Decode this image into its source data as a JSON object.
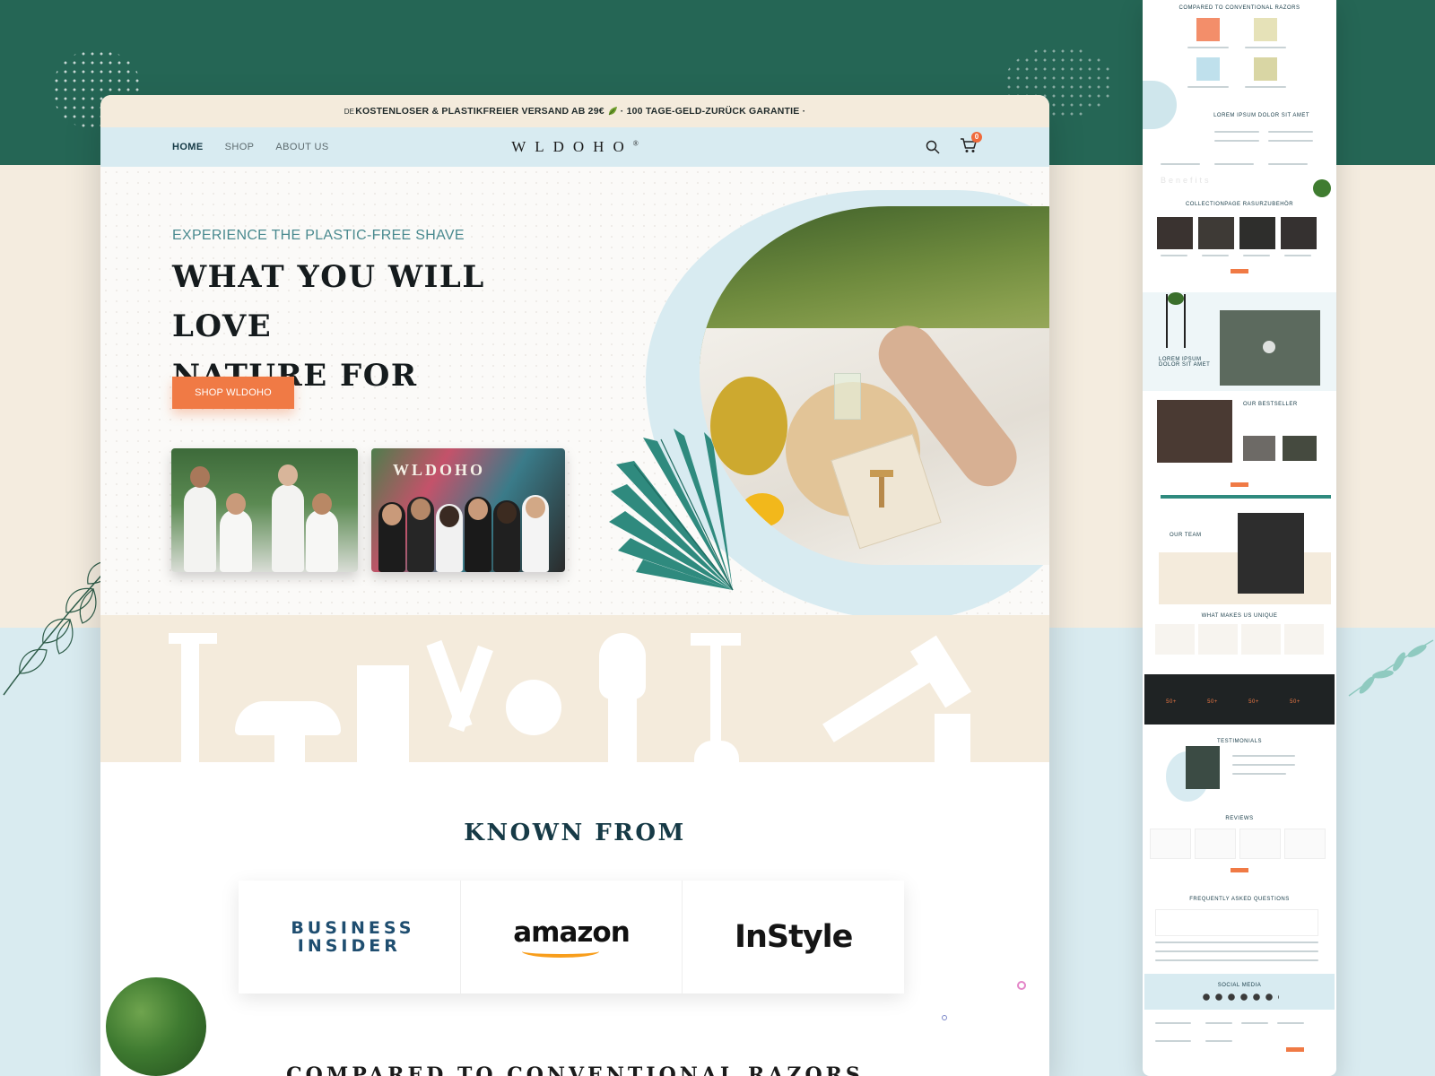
{
  "promo": {
    "lang": "DE",
    "text": "KOSTENLOSER & PLASTIKFREIER VERSAND AB 29€",
    "tail": "· 100 TAGE-GELD-ZURÜCK GARANTIE ·"
  },
  "nav": {
    "links": [
      "HOME",
      "SHOP",
      "ABOUT US"
    ],
    "logo": "WLDOHO",
    "logo_mark": "®",
    "cart_count": "0"
  },
  "hero": {
    "eyebrow": "EXPERIENCE THE PLASTIC-FREE SHAVE",
    "title_line1": "WHAT YOU WILL LOVE",
    "title_line2": "NATURE FOR",
    "cta": "SHOP WLDOHO",
    "team_photo_sign": "WLDOHO"
  },
  "known_from": {
    "title": "KNOWN FROM",
    "brands": [
      "BUSINESS INSIDER",
      "amazon",
      "InStyle"
    ]
  },
  "next_section": {
    "title": "COMPARED TO CONVENTIONAL RAZORS"
  },
  "preview": {
    "sections": [
      "COMPARED TO CONVENTIONAL RAZORS",
      "LOREM IPSUM DOLOR SIT AMET",
      "COLLECTIONPAGE RASURZUBEHÖR",
      "LOREM IPSUM DOLOR SIT AMET",
      "OUR BESTSELLER",
      "OUR TEAM",
      "WHAT MAKES US UNIQUE",
      "TESTIMONIALS",
      "REVIEWS",
      "FREQUENTLY ASKED QUESTIONS",
      "SOCIAL MEDIA"
    ],
    "counter_value": "50+",
    "watermark": "Benefits"
  },
  "colors": {
    "accent": "#f07a45",
    "deep_green": "#256655",
    "sky": "#d8ebf1",
    "sand": "#f4ebdc",
    "navy": "#163a46"
  }
}
